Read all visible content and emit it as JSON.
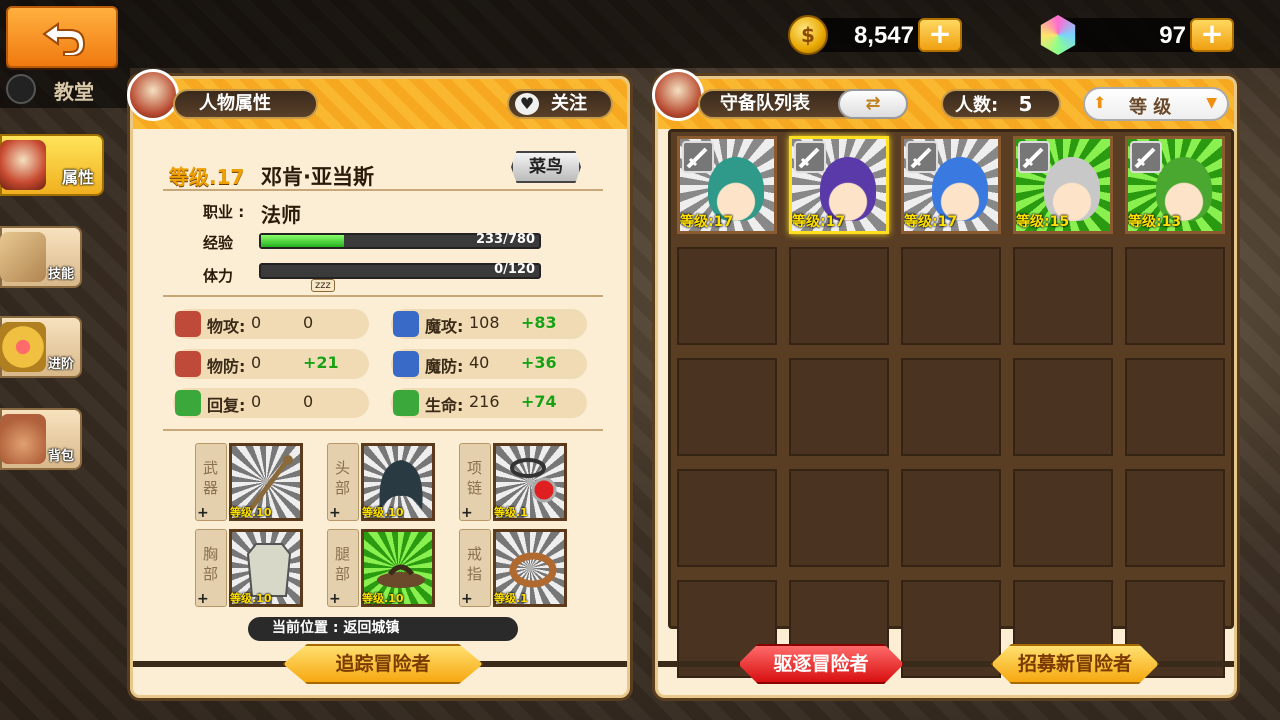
{
  "topbar": {
    "gold": {
      "value": "8,547",
      "plus": "+"
    },
    "gems": {
      "value": "97",
      "plus": "+"
    }
  },
  "side": {
    "church": "教堂",
    "tabs": [
      {
        "label": "属性",
        "active": true
      },
      {
        "label": "技能"
      },
      {
        "label": "进阶"
      },
      {
        "label": "背包"
      }
    ]
  },
  "left_panel": {
    "title": "人物属性",
    "follow": "关注",
    "level": "等级.17",
    "name": "邓肯·亚当斯",
    "rank": "菜鸟",
    "job_label": "职业 :",
    "job": "法师",
    "exp_label": "经验",
    "exp_text": "233/780",
    "exp_fraction": 0.299,
    "stamina_label": "体力",
    "stamina_text": "0/120",
    "zzz": "zzz",
    "stats": [
      {
        "name": "物攻:",
        "base": "0",
        "bonus": "0",
        "green": false
      },
      {
        "name": "魔攻:",
        "base": "108",
        "bonus": "+83",
        "green": true
      },
      {
        "name": "物防:",
        "base": "0",
        "bonus": "+21",
        "green": true
      },
      {
        "name": "魔防:",
        "base": "40",
        "bonus": "+36",
        "green": true
      },
      {
        "name": "回复:",
        "base": "0",
        "bonus": "0",
        "green": false
      },
      {
        "name": "生命:",
        "base": "216",
        "bonus": "+74",
        "green": true
      }
    ],
    "equipment": [
      {
        "slot": "武器",
        "level": "等级.10"
      },
      {
        "slot": "头部",
        "level": "等级.10"
      },
      {
        "slot": "项链",
        "level": "等级.1"
      },
      {
        "slot": "胸部",
        "level": "等级.10"
      },
      {
        "slot": "腿部",
        "level": "等级.10"
      },
      {
        "slot": "戒指",
        "level": "等级.1"
      }
    ],
    "location_label": "当前位置 :",
    "location_value": "返回城镇",
    "track_button": "追踪冒险者"
  },
  "right_panel": {
    "title": "守备队列表",
    "count_label": "人数:",
    "count": "5",
    "sort_label": "等  级",
    "heroes": [
      {
        "level": "等级:17",
        "hair": "#2f9a8a"
      },
      {
        "level": "等级:17",
        "hair": "#5a3aa8",
        "selected": true
      },
      {
        "level": "等级:17",
        "hair": "#3a7ae0"
      },
      {
        "level": "等级:15",
        "hair": "#c8c8c8"
      },
      {
        "level": "等级:13",
        "hair": "#4aa830"
      }
    ],
    "dismiss_button": "驱逐冒险者",
    "recruit_button": "招募新冒险者"
  }
}
